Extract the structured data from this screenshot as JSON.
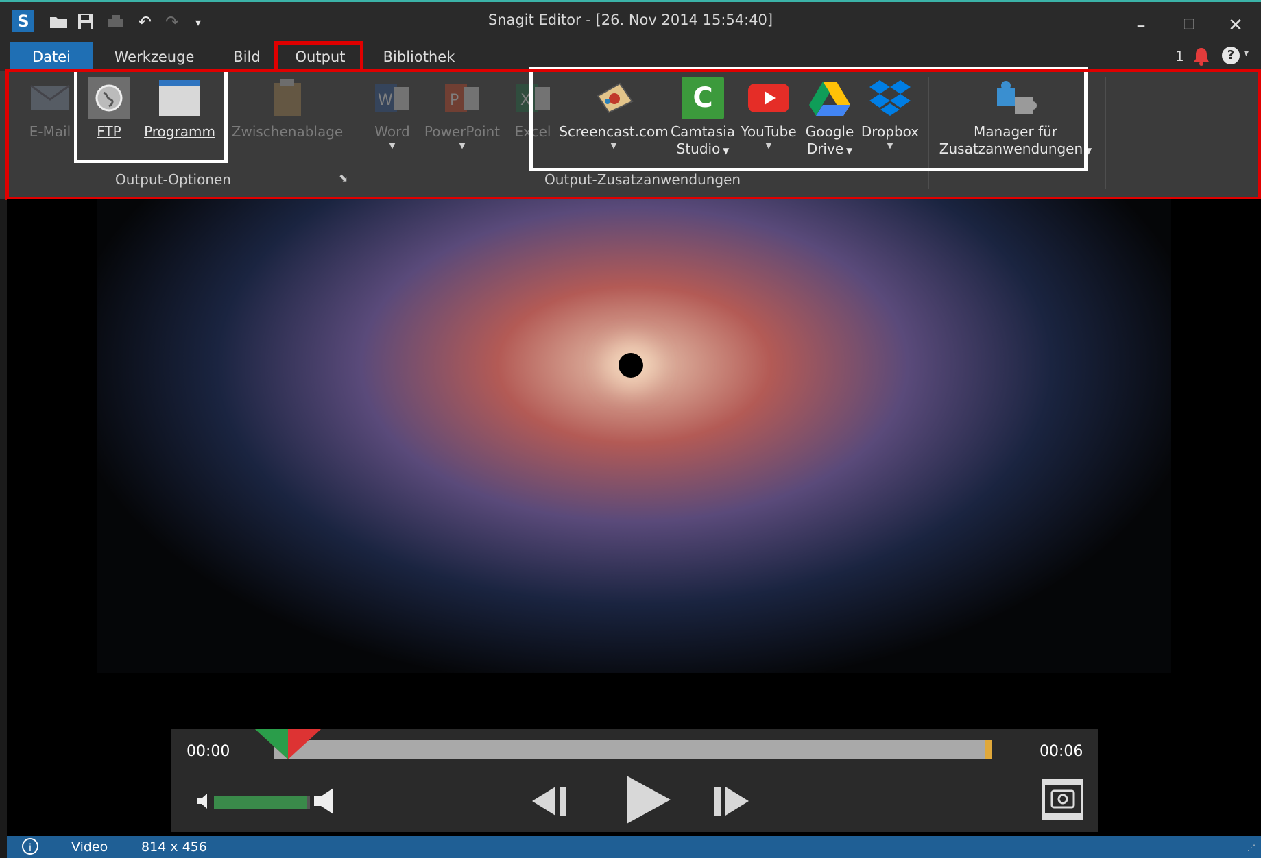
{
  "window": {
    "title": "Snagit Editor - [26. Nov 2014 15:54:40]",
    "notification_count": "1"
  },
  "tabs": [
    {
      "label": "Datei"
    },
    {
      "label": "Werkzeuge"
    },
    {
      "label": "Bild"
    },
    {
      "label": "Output"
    },
    {
      "label": "Bibliothek"
    }
  ],
  "ribbon": {
    "output_options": {
      "group_label": "Output-Optionen",
      "email": "E-Mail",
      "ftp": "FTP",
      "programm": "Programm",
      "clipboard": "Zwischenablage"
    },
    "output_addons": {
      "group_label": "Output-Zusatzanwendungen",
      "word": "Word",
      "powerpoint": "PowerPoint",
      "excel": "Excel",
      "screencast": "Screencast.com",
      "camtasia_line1": "Camtasia",
      "camtasia_line2": "Studio",
      "youtube": "YouTube",
      "gdrive_line1": "Google",
      "gdrive_line2": "Drive",
      "dropbox": "Dropbox"
    },
    "manager": {
      "line1": "Manager für",
      "line2": "Zusatzanwendungen"
    }
  },
  "player": {
    "time_start": "00:00",
    "time_end": "00:06",
    "volume_level": 0.97
  },
  "status": {
    "type": "Video",
    "dimensions": "814 x 456"
  },
  "colors": {
    "accent_blue": "#1f6fb4",
    "highlight_red": "#e00000",
    "status_blue": "#1f5f95"
  }
}
